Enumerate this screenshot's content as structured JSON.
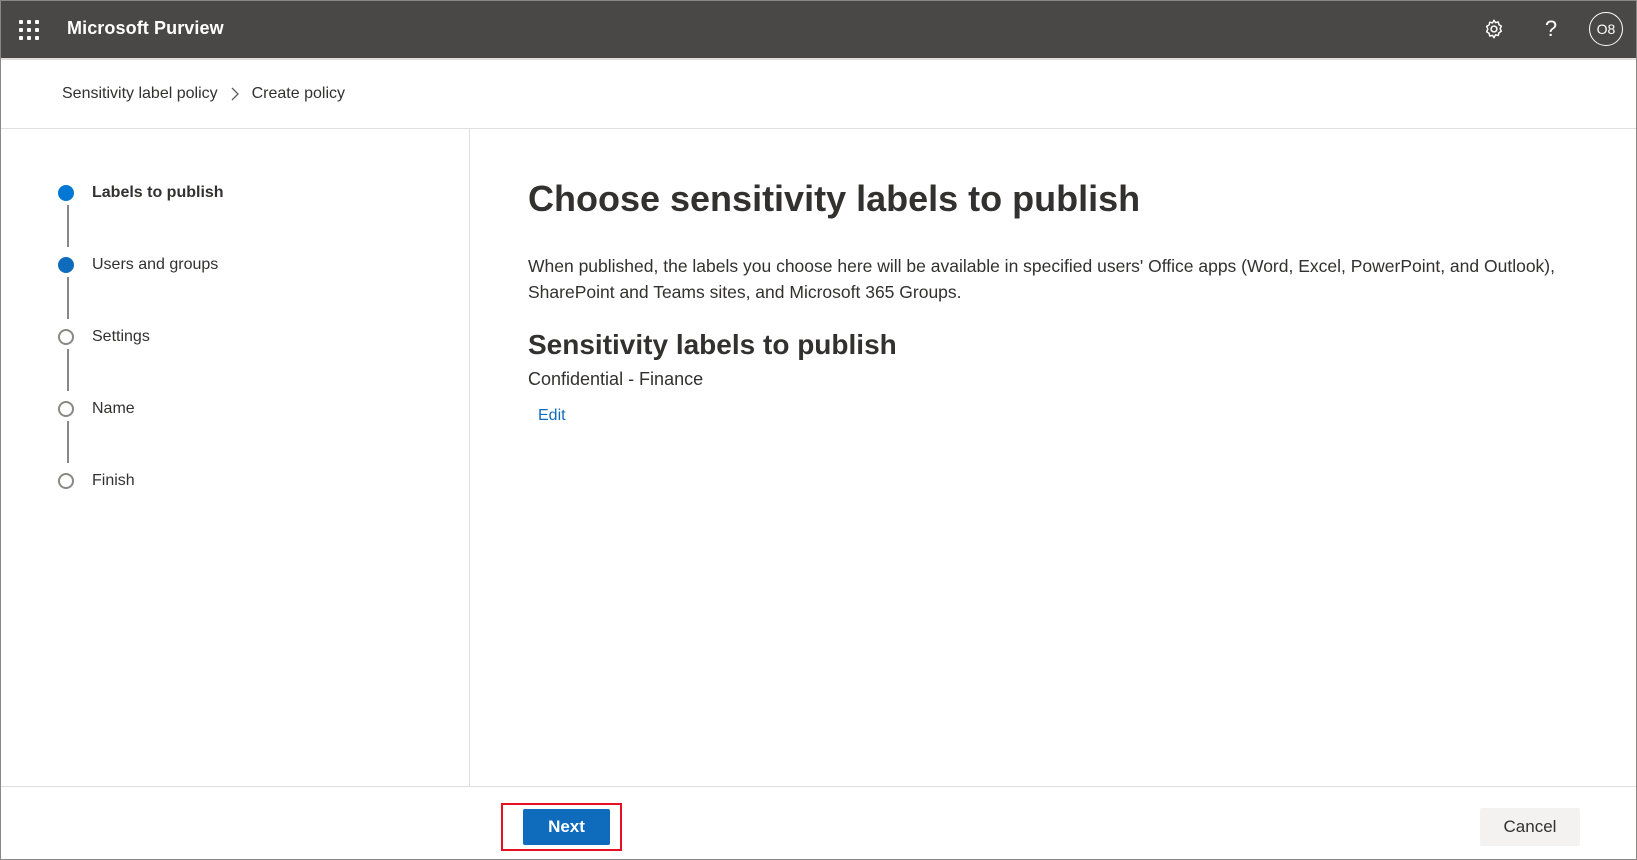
{
  "app": {
    "title": "Microsoft Purview",
    "avatar_initials": "O8",
    "help_glyph": "?",
    "icons": [
      "waffle-icon",
      "settings-icon",
      "help-icon"
    ]
  },
  "breadcrumb": {
    "items": [
      "Sensitivity label policy",
      "Create policy"
    ],
    "separator_icon": "chevron-right-icon"
  },
  "steps": [
    {
      "label": "Labels to publish",
      "state": "current"
    },
    {
      "label": "Users and groups",
      "state": "done"
    },
    {
      "label": "Settings",
      "state": "pending"
    },
    {
      "label": "Name",
      "state": "pending"
    },
    {
      "label": "Finish",
      "state": "pending"
    }
  ],
  "main": {
    "title": "Choose sensitivity labels to publish",
    "description": "When published, the labels you choose here will be available in specified users' Office apps (Word, Excel, PowerPoint, and Outlook), SharePoint and Teams sites, and Microsoft 365 Groups.",
    "section_title": "Sensitivity labels to publish",
    "selected_label": "Confidential - Finance",
    "edit_link": "Edit"
  },
  "footer": {
    "next_label": "Next",
    "cancel_label": "Cancel"
  },
  "colors": {
    "topbar": "#4a4846",
    "accent": "#0f6cbd",
    "highlight": "#e81123"
  }
}
